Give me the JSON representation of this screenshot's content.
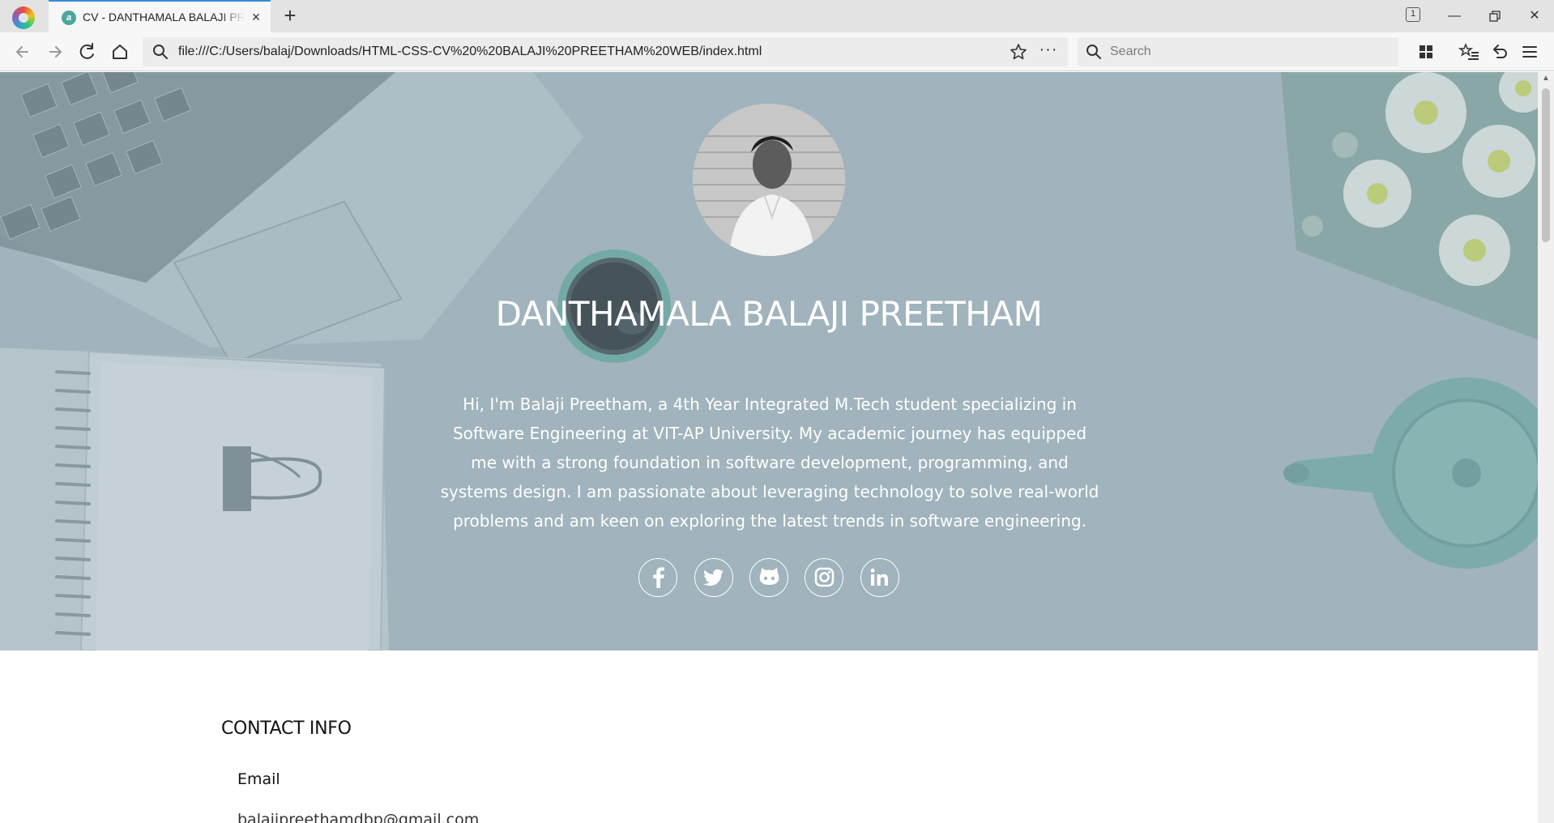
{
  "browser": {
    "tab_title": "CV - DANTHAMALA BALAJI PREETHAM",
    "tab_count": "1",
    "url": "file:///C:/Users/balaj/Downloads/HTML-CSS-CV%20%20BALAJI%20PREETHAM%20WEB/index.html",
    "search_placeholder": "Search"
  },
  "hero": {
    "name": "DANTHAMALA BALAJI PREETHAM",
    "bio": "Hi, I'm Balaji Preetham, a 4th Year Integrated M.Tech student specializing in Software Engineering at VIT-AP University. My academic journey has equipped me with a strong foundation in software development, programming, and systems design. I am passionate about leveraging technology to solve real-world problems and am keen on exploring the latest trends in software engineering.",
    "socials": [
      "facebook-icon",
      "twitter-icon",
      "github-icon",
      "instagram-icon",
      "linkedin-icon"
    ]
  },
  "contact": {
    "title": "CONTACT INFO",
    "email_label": "Email",
    "email_value": "balajipreethamdbp@gmail.com"
  }
}
